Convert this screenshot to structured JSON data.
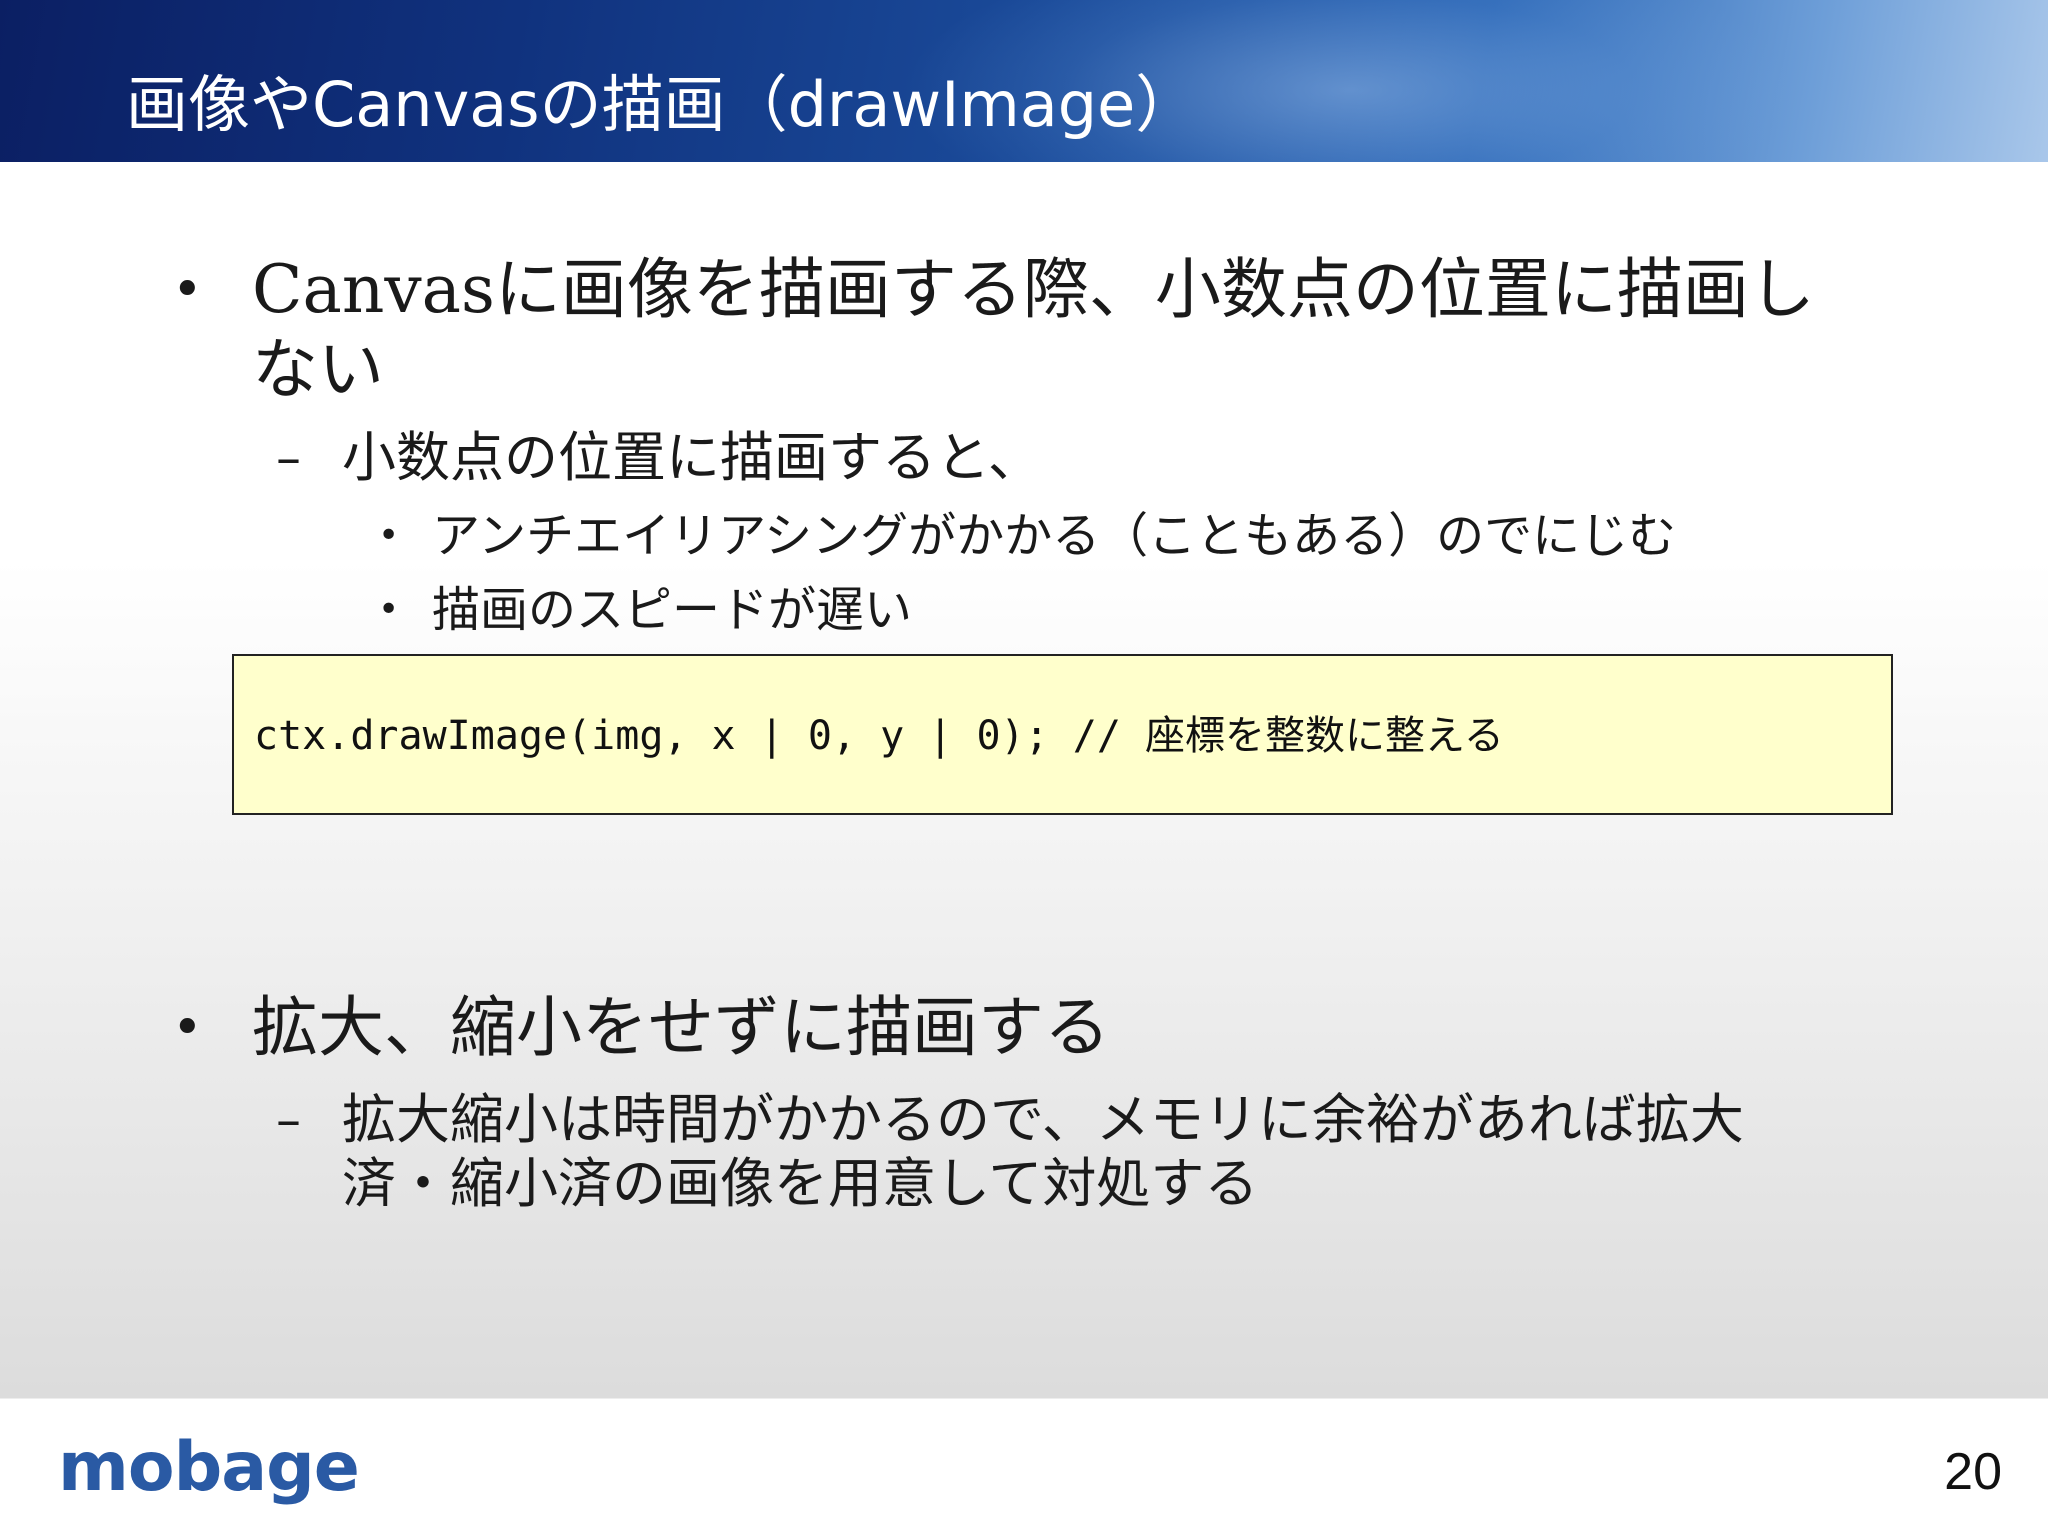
{
  "slide": {
    "title": "画像やCanvasの描画（drawImage）",
    "bullets": [
      {
        "line1": "Canvasに画像を描画する際、小数点の位置に描画し",
        "line2": "ない",
        "sub": "小数点の位置に描画すると、",
        "subsub": [
          "アンチエイリアシングがかかる（こともある）のでにじむ",
          "描画のスピードが遅い"
        ]
      },
      {
        "line1": "拡大、縮小をせずに描画する",
        "sub_line1": "拡大縮小は時間がかかるので、メモリに余裕があれば拡大",
        "sub_line2": "済・縮小済の画像を用意して対処する"
      }
    ],
    "code": "ctx.drawImage(img, x | 0, y | 0); // 座標を整数に整える",
    "bullet_symbol": "•",
    "dash_symbol": "–"
  },
  "footer": {
    "logo": "mobage",
    "page_number": "20"
  },
  "colors": {
    "title_bar": "#10327e",
    "code_background": "#ffffcc",
    "logo": "#2a5aa4"
  }
}
